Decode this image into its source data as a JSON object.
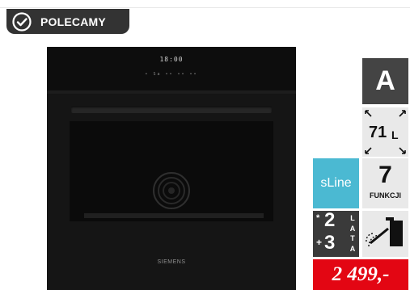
{
  "badge": {
    "label": "POLECAMY",
    "icon": "check-circle-icon"
  },
  "oven": {
    "display_time": "18:00",
    "display_row": "• Sa •• •• ••",
    "brand": "SIEMENS"
  },
  "features": {
    "energy_class": "A",
    "capacity_value": "71",
    "capacity_unit": "L",
    "series": "sLine",
    "functions_count": "7",
    "functions_label": "FUNKCJI",
    "warranty_star": "*",
    "warranty_base": "2",
    "warranty_plus": "+",
    "warranty_extra": "3",
    "warranty_unit": [
      "L",
      "A",
      "T",
      "A"
    ]
  },
  "price": "2 499,-",
  "colors": {
    "badge_bg": "#333333",
    "energy_bg": "#444444",
    "sline_bg": "#4bb9d2",
    "price_bg": "#e30613",
    "tile_bg": "#e9e9e9"
  }
}
